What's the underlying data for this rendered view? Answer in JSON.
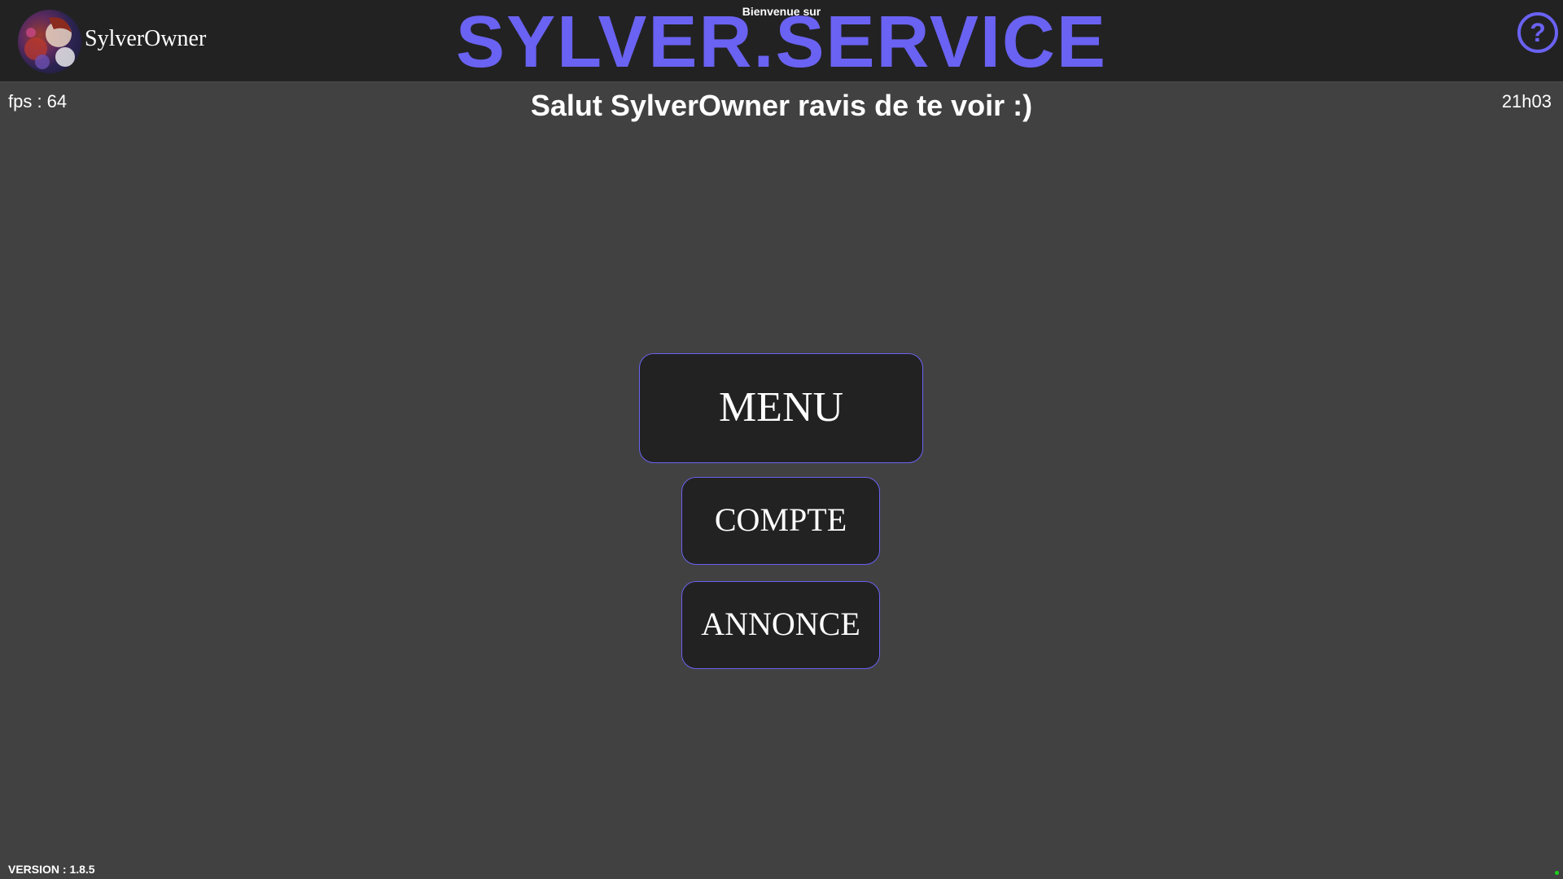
{
  "header": {
    "username": "SylverOwner",
    "welcome": "Bienvenue sur",
    "brand": "SYLVER.SERVICE",
    "help_glyph": "?",
    "avatar_icon": "user-avatar-icon",
    "help_icon": "help-icon"
  },
  "stats": {
    "fps": "fps : 64",
    "time": "21h03"
  },
  "greeting": "Salut SylverOwner ravis de te voir :)",
  "menu": {
    "menu_label": "MENU",
    "compte_label": "COMPTE",
    "annonce_label": "ANNONCE"
  },
  "footer": {
    "version": "VERSION : 1.8.5"
  },
  "colors": {
    "background": "#414141",
    "header_bg": "#222223",
    "accent": "#6a62f2",
    "button_bg": "#222223",
    "status_ok": "#1bd11b"
  }
}
